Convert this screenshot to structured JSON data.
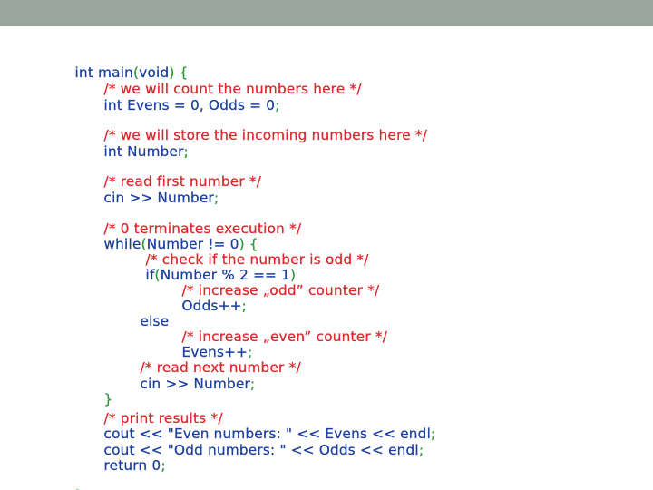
{
  "colors": {
    "top_bar": "#9ba69f",
    "code": "#1a3fa0",
    "comment": "#e0262b",
    "paren": "#2e9a3a"
  },
  "code": {
    "l01": {
      "a": "int main",
      "b": "(",
      "c": "void",
      "d": ") {"
    },
    "l02": {
      "a": "/* we will count the numbers here */"
    },
    "l03": {
      "a": "int Evens = 0, Odds = 0",
      "b": ";"
    },
    "l04": {
      "a": "/* we will store the incoming numbers here */"
    },
    "l05": {
      "a": "int Number",
      "b": ";"
    },
    "l06": {
      "a": "/* read first number */"
    },
    "l07": {
      "a": "cin >> Number",
      "b": ";"
    },
    "l08": {
      "a": "/* 0 terminates execution */"
    },
    "l09": {
      "a": "while",
      "b": "(",
      "c": "Number != 0",
      "d": ") {"
    },
    "l10": {
      "a": "/* check if the number is odd */"
    },
    "l11": {
      "a": "if",
      "b": "(",
      "c": "Number % 2 == 1",
      "d": ")"
    },
    "l12": {
      "a": "/* increase „odd” counter */"
    },
    "l13": {
      "a": "Odds++",
      "b": ";"
    },
    "l14": {
      "a": "else"
    },
    "l15": {
      "a": "/* increase „even” counter */"
    },
    "l16": {
      "a": "Evens++",
      "b": ";"
    },
    "l17": {
      "a": "/* read next number */"
    },
    "l18": {
      "a": "cin >> Number",
      "b": ";"
    },
    "l19": {
      "a": "}"
    },
    "l20": {
      "a": "/* print results */"
    },
    "l21": {
      "a": "cout << \"Even numbers: \" << Evens << endl",
      "b": ";"
    },
    "l22": {
      "a": "cout << \"Odd numbers: \" << Odds << endl",
      "b": ";"
    },
    "l23": {
      "a": "return 0",
      "b": ";"
    },
    "l24": {
      "a": "}"
    }
  }
}
